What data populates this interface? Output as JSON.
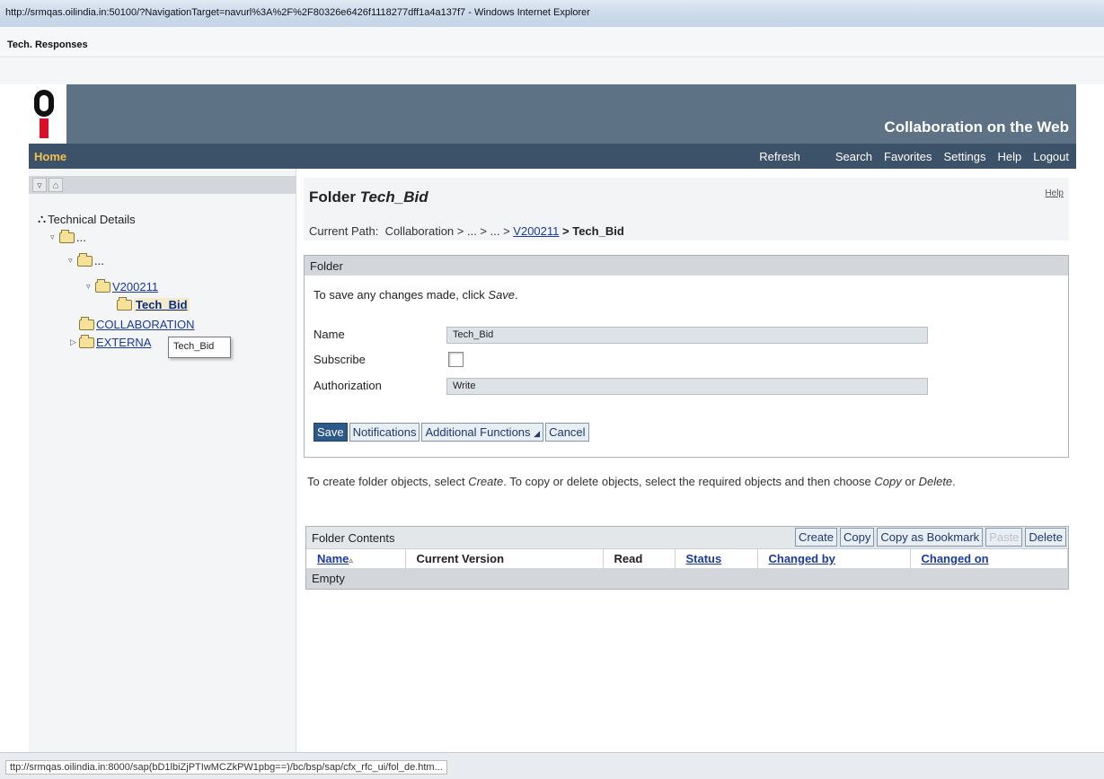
{
  "window": {
    "title": "http://srmqas.oilindia.in:50100/?NavigationTarget=navurl%3A%2F%2F80326e6426f1118277dff1a4a137f7 - Windows Internet Explorer",
    "tab_title": "Tech. Responses"
  },
  "header": {
    "brand": "Collaboration on the Web",
    "logo_icon": "company-logo-icon"
  },
  "nav": {
    "home": "Home",
    "links": [
      "Refresh",
      "Search",
      "Favorites",
      "Settings",
      "Help",
      "Logout"
    ]
  },
  "tree": {
    "root": "Technical Details",
    "ellipsis_1": "...",
    "ellipsis_2": "...",
    "v_node": "V200211",
    "selected": "Tech_Bid",
    "collaboration": "COLLABORATION",
    "external": "EXTERNA",
    "tooltip": "Tech_Bid"
  },
  "folder": {
    "title_prefix": "Folder",
    "title_name": "Tech_Bid",
    "help": "Help",
    "path_label": "Current Path:",
    "path_text": "Collaboration > ... > ... >",
    "path_link": "V200211",
    "path_current": "> Tech_Bid"
  },
  "folder_box": {
    "header": "Folder",
    "note_prefix": "To save any changes made, click",
    "note_em": "Save",
    "note_suffix": ".",
    "name_label": "Name",
    "name_value": "Tech_Bid",
    "subscribe_label": "Subscribe",
    "subscribe_checked": false,
    "auth_label": "Authorization",
    "auth_value": "Write",
    "buttons": [
      "Save",
      "Notifications",
      "Additional Functions",
      "Cancel"
    ]
  },
  "info": {
    "p1": "To create folder objects, select",
    "em1": "Create",
    "p2": ". To copy or delete objects, select the required objects and then choose",
    "em2": "Copy",
    "p3": "or",
    "em3": "Delete",
    "p4": "."
  },
  "contents": {
    "title": "Folder Contents",
    "buttons": [
      "Create",
      "Copy",
      "Copy as Bookmark",
      "Paste",
      "Delete"
    ],
    "columns": [
      "Name",
      "Current Version",
      "Read",
      "Status",
      "Changed by",
      "Changed on"
    ],
    "empty_text": "Empty"
  },
  "statusbar": {
    "url": "ttp://srmqas.oilindia.in:8000/sap(bD1lbiZjPTIwMCZkPW1pbg==)/bc/bsp/sap/cfx_rfc_ui/fol_de.htm..."
  },
  "colors": {
    "header_bg": "#5e7286",
    "nav_bg": "#3c5268",
    "home_color": "#f2c14d",
    "link_color": "#1a3aa0"
  }
}
